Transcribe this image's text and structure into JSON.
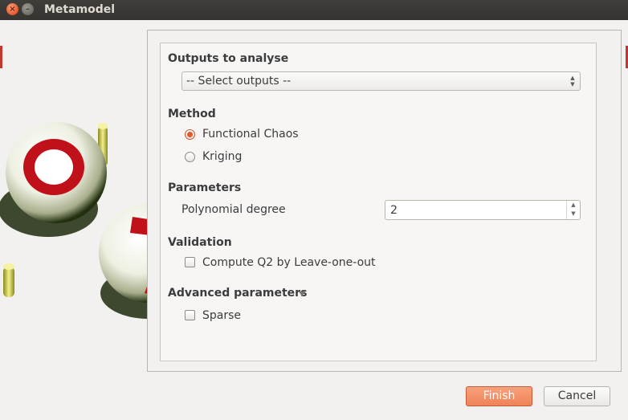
{
  "window": {
    "title": "Metamodel"
  },
  "colors": {
    "accent": "#e05a2b",
    "titlebar": "#3c3b37",
    "finish_button": "#f28b63"
  },
  "wizard_image": {
    "icon": "openturns-logo-spheres"
  },
  "outputs": {
    "heading": "Outputs to analyse",
    "select_value": "-- Select outputs --"
  },
  "method": {
    "heading": "Method",
    "options": [
      {
        "label": "Functional Chaos",
        "checked": true
      },
      {
        "label": "Kriging",
        "checked": false
      }
    ]
  },
  "parameters": {
    "heading": "Parameters",
    "polynomial_degree_label": "Polynomial degree",
    "polynomial_degree_value": "2"
  },
  "validation": {
    "heading": "Validation",
    "q2_label": "Compute Q2 by Leave-one-out",
    "q2_checked": false
  },
  "advanced": {
    "heading": "Advanced parameters",
    "sparse_label": "Sparse",
    "sparse_checked": false
  },
  "buttons": {
    "finish": "Finish",
    "cancel": "Cancel"
  }
}
